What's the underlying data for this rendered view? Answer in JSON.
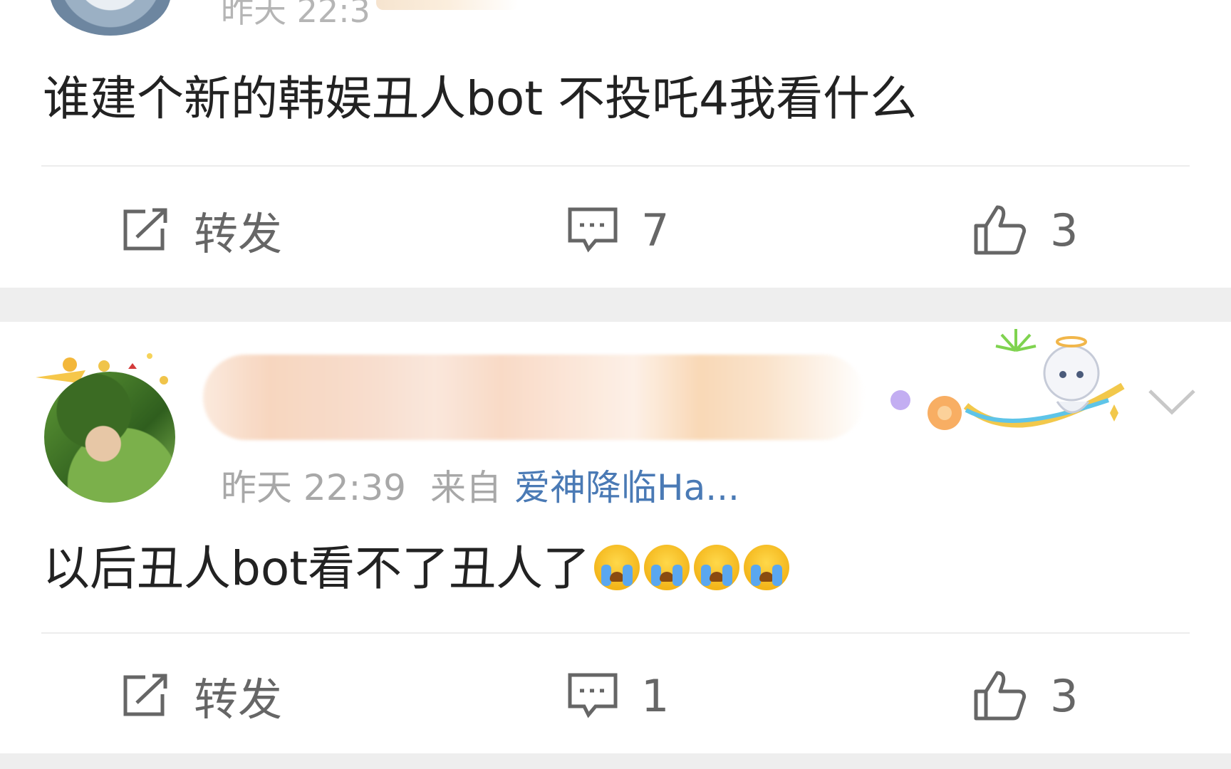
{
  "post1": {
    "time_partial": "昨天 22:3",
    "text": "谁建个新的韩娱丑人bot 不投吒4我看什么",
    "actions": {
      "repost_label": "转发",
      "comments": "7",
      "likes": "3"
    }
  },
  "post2": {
    "time": "昨天 22:39",
    "from_label": "来自",
    "source": "爱神降临Ha...",
    "text": "以后丑人bot看不了丑人了",
    "emoji_count": 4,
    "emoji_name": "crying-emoji",
    "actions": {
      "repost_label": "转发",
      "comments": "1",
      "likes": "3"
    }
  },
  "colors": {
    "background": "#eeeeee",
    "card": "#ffffff",
    "text": "#222222",
    "meta": "#a8a8a8",
    "link": "#4a7ab5",
    "action": "#666666"
  }
}
